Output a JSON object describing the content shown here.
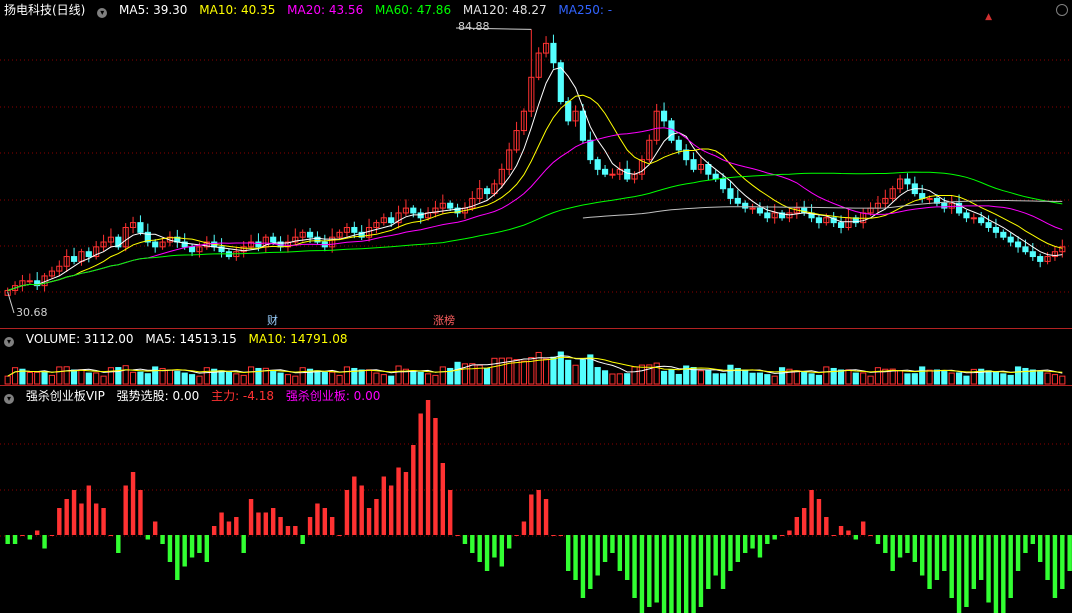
{
  "price_header": {
    "stock_name": "扬电科技(日线)",
    "ma5": "MA5: 39.30",
    "ma10": "MA10: 40.35",
    "ma20": "MA20: 43.56",
    "ma60": "MA60: 47.86",
    "ma120": "MA120: 48.27",
    "ma250": "MA250: -"
  },
  "volume_header": {
    "volume": "VOLUME: 3112.00",
    "ma5": "MA5: 14513.15",
    "ma10": "MA10: 14791.08"
  },
  "indicator_header": {
    "name": "强杀创业板VIP",
    "strong_pick": "强势选股: 0.00",
    "main_force": "主力: -4.18",
    "board": "强杀创业板: 0.00"
  },
  "price_labels": {
    "high": "84.88",
    "low": "30.68",
    "tag_cai": "财",
    "tag_zhangting": "涨榜"
  },
  "colors": {
    "bg": "#000000",
    "up": "#ff3232",
    "down": "#54ffff",
    "ma5": "#ffffff",
    "ma10": "#ffff00",
    "ma20": "#ff00ff",
    "ma60": "#00ff00",
    "ma120": "#c0c0c0",
    "ma250": "#3264ff",
    "grid": "#8b0000"
  },
  "chart_data": {
    "type": "candlestick",
    "high": 84.88,
    "low": 30.68,
    "closes": [
      31,
      32,
      33,
      33,
      32,
      34,
      35,
      36,
      38,
      37,
      39,
      38,
      40,
      41,
      42,
      40,
      44,
      45,
      43,
      41,
      40,
      41,
      42,
      41,
      40,
      39,
      40,
      41,
      40,
      39,
      38,
      39,
      40,
      41,
      40,
      42,
      41,
      40,
      41,
      42,
      43,
      42,
      41,
      40,
      42,
      43,
      44,
      43,
      42,
      44,
      45,
      46,
      45,
      47,
      48,
      47,
      46,
      47,
      48,
      49,
      48,
      47,
      48,
      50,
      52,
      51,
      53,
      56,
      60,
      64,
      68,
      75,
      80,
      82,
      78,
      70,
      66,
      68,
      62,
      58,
      56,
      55,
      55,
      56,
      54,
      55,
      58,
      62,
      68,
      66,
      62,
      60,
      58,
      56,
      57,
      55,
      54,
      52,
      50,
      49,
      48,
      48,
      47,
      46,
      47,
      46,
      47,
      48,
      47,
      46,
      45,
      46,
      45,
      44,
      46,
      45,
      47,
      48,
      49,
      50,
      52,
      54,
      53,
      51,
      50,
      50,
      49,
      48,
      49,
      47,
      46,
      46,
      45,
      44,
      43,
      42,
      41,
      40,
      39,
      38,
      37,
      38,
      39,
      40
    ],
    "volume_up": [
      true,
      true,
      false,
      true,
      true,
      false,
      true,
      true,
      true,
      false,
      true,
      false,
      true,
      true,
      true,
      false,
      true,
      true,
      false,
      false,
      false,
      true,
      true,
      false,
      false,
      false,
      true,
      true,
      false,
      false,
      false,
      true,
      true,
      true,
      false,
      true,
      false,
      false,
      true,
      true,
      true,
      false,
      false,
      false,
      true,
      true,
      true,
      false,
      false,
      true,
      true,
      true,
      false,
      true,
      true,
      false,
      false,
      true,
      true,
      true,
      false,
      false,
      true,
      true,
      true,
      false,
      true,
      true,
      true,
      true,
      true,
      true,
      true,
      true,
      false,
      false,
      false,
      true,
      false,
      false,
      false,
      false,
      true,
      true,
      false,
      true,
      true,
      true,
      true,
      false,
      false,
      false,
      false,
      false,
      true,
      false,
      false,
      false,
      false,
      false,
      false,
      false,
      false,
      false,
      true,
      false,
      true,
      true,
      false,
      false,
      false,
      true,
      false,
      false,
      true,
      false,
      true,
      true,
      true,
      true,
      true,
      true,
      false,
      false,
      false,
      true,
      false,
      false,
      true,
      false,
      false,
      true,
      false,
      false,
      false,
      false,
      false,
      false,
      false,
      false,
      false,
      true,
      true,
      true
    ],
    "indicator": [
      -2,
      -2,
      0,
      -1,
      1,
      -3,
      0,
      6,
      8,
      10,
      7,
      11,
      7,
      6,
      0,
      -4,
      11,
      14,
      10,
      -1,
      3,
      -2,
      -6,
      -10,
      -7,
      -5,
      -4,
      -6,
      2,
      5,
      3,
      4,
      -4,
      8,
      5,
      5,
      6,
      4,
      2,
      2,
      -2,
      4,
      7,
      6,
      4,
      0,
      10,
      13,
      11,
      6,
      8,
      13,
      11,
      15,
      14,
      20,
      27,
      30,
      26,
      16,
      10,
      0,
      -2,
      -4,
      -6,
      -8,
      -5,
      -7,
      -3,
      0,
      3,
      9,
      10,
      8,
      0,
      0,
      -8,
      -10,
      -14,
      -12,
      -9,
      -6,
      -4,
      -8,
      -10,
      -14,
      -18,
      -16,
      -15,
      -18,
      -22,
      -20,
      -18,
      -21,
      -16,
      -12,
      -9,
      -12,
      -8,
      -6,
      -4,
      -3,
      -5,
      -2,
      -1,
      0,
      1,
      4,
      6,
      10,
      8,
      4,
      0,
      2,
      1,
      -1,
      3,
      0,
      -2,
      -4,
      -8,
      -5,
      -4,
      -6,
      -9,
      -12,
      -10,
      -8,
      -14,
      -18,
      -16,
      -12,
      -10,
      -15,
      -20,
      -18,
      -14,
      -8,
      -4,
      -2,
      -6,
      -10,
      -14,
      -12,
      -8,
      -4
    ]
  }
}
